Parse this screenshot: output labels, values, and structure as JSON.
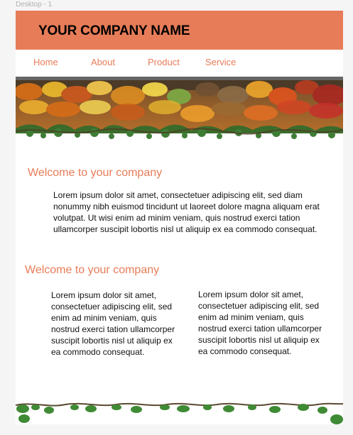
{
  "window": {
    "frame_label": "Desktop - 1"
  },
  "header": {
    "company_name": "YOUR COMPANY NAME",
    "background_color": "#e77c58",
    "text_color": "#000000"
  },
  "nav": {
    "items": [
      {
        "label": "Home"
      },
      {
        "label": "About"
      },
      {
        "label": "Product"
      },
      {
        "label": "Service"
      }
    ],
    "text_color": "#e77c58"
  },
  "hero": {
    "image_icon": "autumn-leaves-banner-icon"
  },
  "sections": [
    {
      "heading": "Welcome to your company",
      "paragraphs": [
        "Lorem ipsum dolor sit amet, consectetuer adipiscing elit, sed diam nonummy nibh euismod tincidunt ut laoreet dolore magna aliquam erat volutpat. Ut wisi enim ad minim veniam, quis nostrud exerci tation ullamcorper suscipit lobortis nisl ut aliquip ex ea commodo consequat."
      ]
    },
    {
      "heading": "Welcome to your company",
      "paragraphs": [
        "Lorem ipsum dolor sit amet, consectetuer adipiscing elit, sed enim ad minim veniam, quis nostrud exerci tation ullamcorper suscipit lobortis nisl ut aliquip ex ea commodo consequat.",
        "Lorem ipsum dolor sit amet, consectetuer adipiscing elit, sed enim ad minim veniam, quis nostrud exerci tation ullamcorper suscipit lobortis nisl ut aliquip ex ea commodo consequat."
      ]
    }
  ],
  "footer": {
    "image_icon": "leaf-vine-border-icon"
  }
}
